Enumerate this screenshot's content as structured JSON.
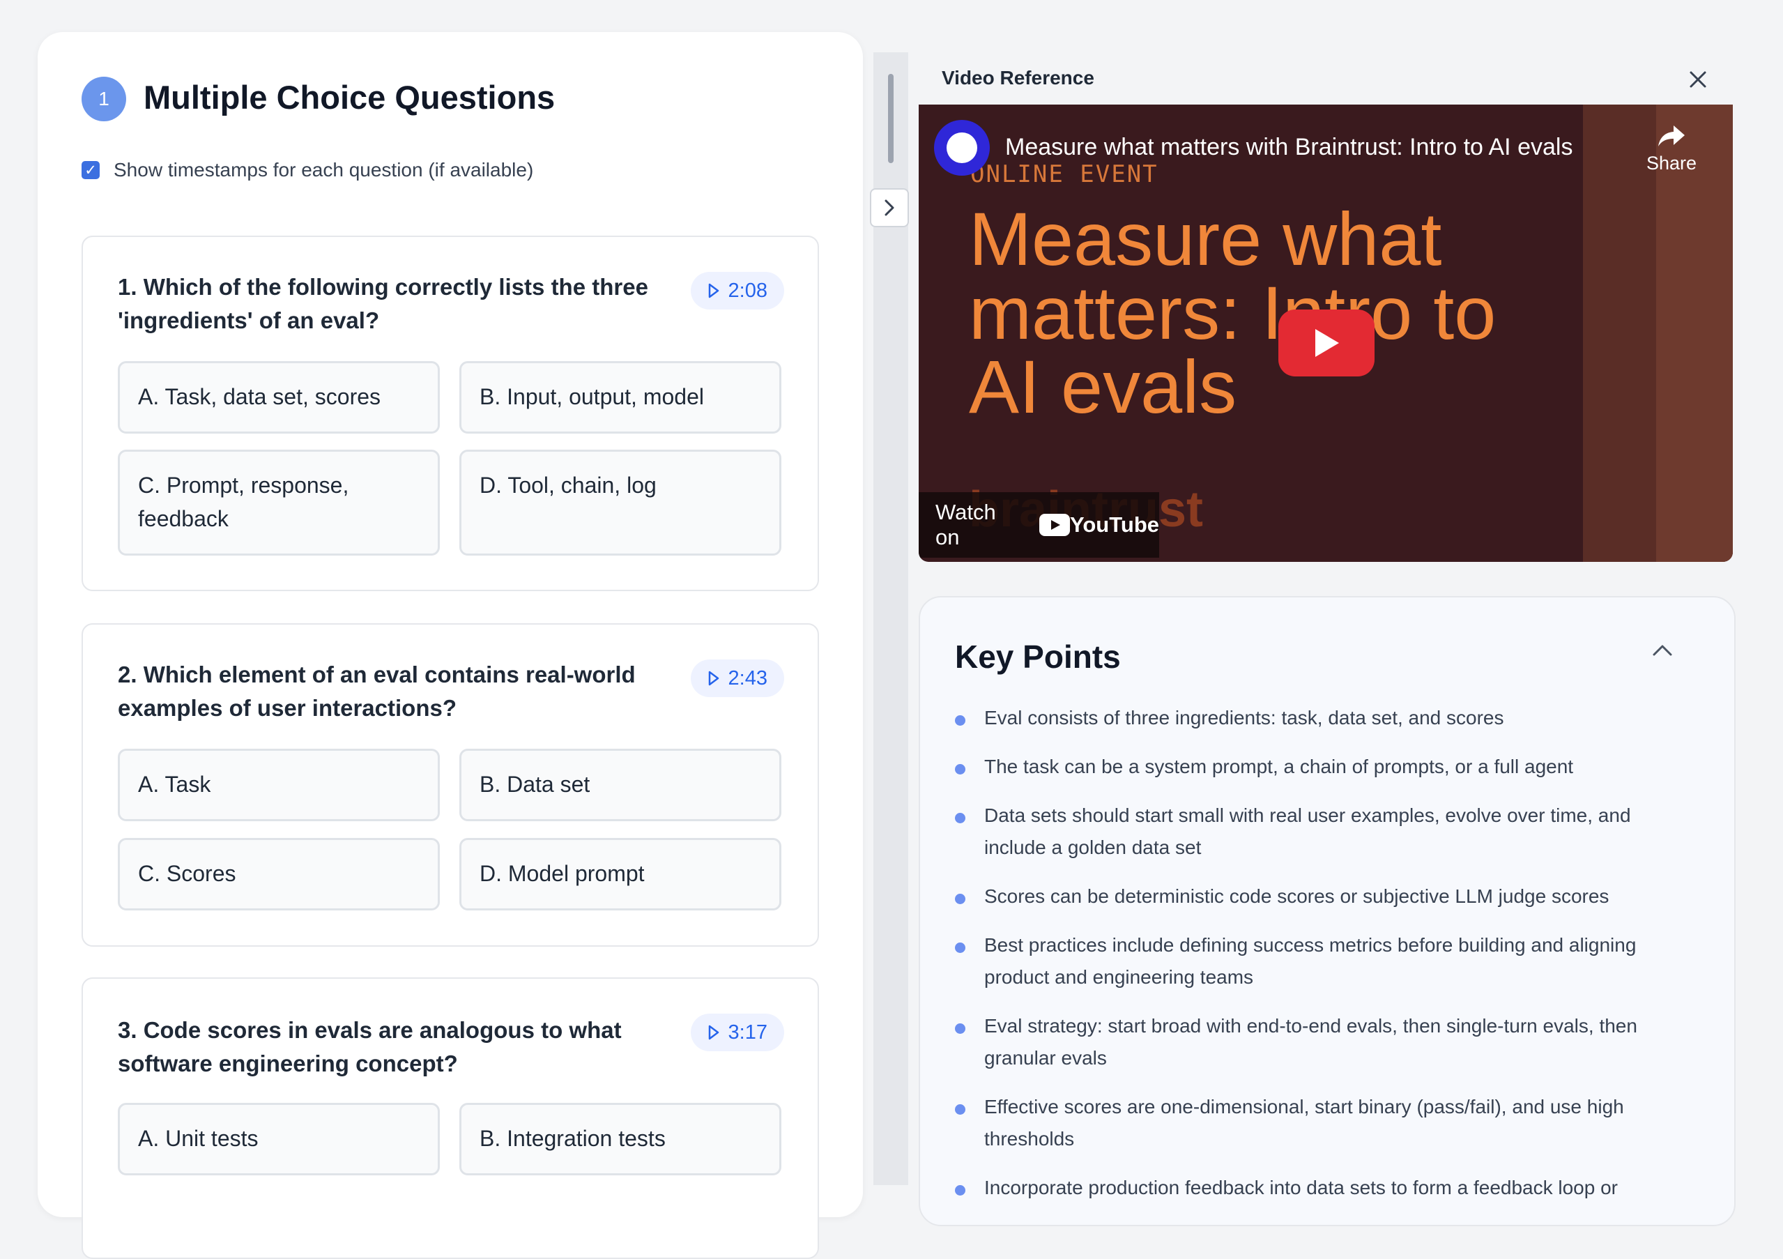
{
  "quiz": {
    "step_number": "1",
    "title": "Multiple Choice Questions",
    "show_timestamps_label": "Show timestamps for each question (if available)",
    "show_timestamps_checked": true,
    "questions": [
      {
        "text": "1. Which of the following correctly lists the three 'ingredients' of an eval?",
        "timestamp": "2:08",
        "options": [
          "A. Task, data set, scores",
          "B. Input, output, model",
          "C. Prompt, response, feedback",
          "D. Tool, chain, log"
        ]
      },
      {
        "text": "2. Which element of an eval contains real-world examples of user interactions?",
        "timestamp": "2:43",
        "options": [
          "A. Task",
          "B. Data set",
          "C. Scores",
          "D. Model prompt"
        ]
      },
      {
        "text": "3. Code scores in evals are analogous to what software engineering concept?",
        "timestamp": "3:17",
        "options": [
          "A. Unit tests",
          "B. Integration tests"
        ]
      }
    ]
  },
  "video": {
    "header_title": "Video Reference",
    "yt_title": "Measure what matters with Braintrust: Intro to AI evals",
    "share_label": "Share",
    "thumb_event": "ONLINE EVENT",
    "thumb_headline": "Measure what matters: Intro to AI evals",
    "thumb_brand": "braintrust",
    "watch_on": "Watch on",
    "youtube_label": "YouTube"
  },
  "key_points": {
    "title": "Key Points",
    "items": [
      "Eval consists of three ingredients: task, data set, and scores",
      "The task can be a system prompt, a chain of prompts, or a full agent",
      "Data sets should start small with real user examples, evolve over time, and include a golden data set",
      "Scores can be deterministic code scores or subjective LLM judge scores",
      "Best practices include defining success metrics before building and aligning product and engineering teams",
      "Eval strategy: start broad with end-to-end evals, then single-turn evals, then granular evals",
      "Effective scores are one-dimensional, start binary (pass/fail), and use high thresholds",
      "Incorporate production feedback into data sets to form a feedback loop or"
    ]
  },
  "colors": {
    "accent": "#6b96ec",
    "link_blue": "#2563eb",
    "youtube_red": "#e32a33",
    "thumb_orange": "#f0873a"
  }
}
